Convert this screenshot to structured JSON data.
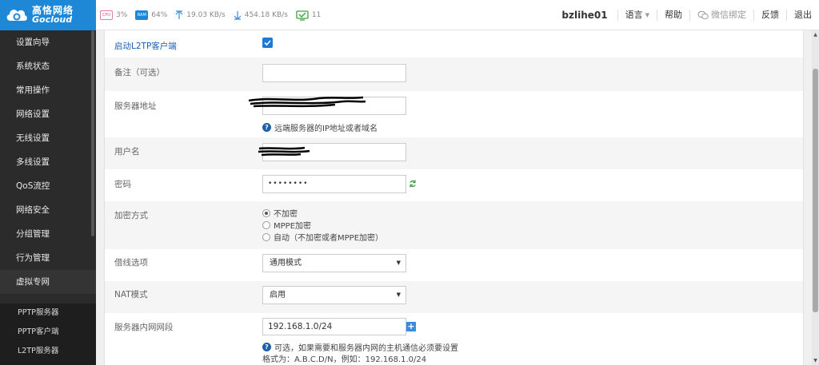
{
  "app": {
    "logo_cn": "高恪网络",
    "logo_en": "Gocloud"
  },
  "stats": {
    "cpu_badge": "CPU",
    "cpu": "3%",
    "ram_badge": "RAM",
    "ram": "64%",
    "upload": "19.03 KB/s",
    "download": "454.18 KB/s",
    "devices": "11"
  },
  "topnav": {
    "user": "bzlihe01",
    "language": "语言",
    "help": "帮助",
    "wechat": "微信绑定",
    "feedback": "反馈",
    "logout": "退出"
  },
  "sidebar": {
    "items": [
      {
        "label": "设置向导"
      },
      {
        "label": "系统状态"
      },
      {
        "label": "常用操作"
      },
      {
        "label": "网络设置"
      },
      {
        "label": "无线设置"
      },
      {
        "label": "多线设置"
      },
      {
        "label": "QoS流控"
      },
      {
        "label": "网络安全"
      },
      {
        "label": "分组管理"
      },
      {
        "label": "行为管理"
      },
      {
        "label": "虚拟专网"
      }
    ],
    "subitems": [
      {
        "label": "PPTP服务器"
      },
      {
        "label": "PPTP客户端"
      },
      {
        "label": "L2TP服务器"
      }
    ]
  },
  "form": {
    "enable_label": "启动L2TP客户端",
    "enable_checked": true,
    "note_label": "备注（可选）",
    "note_value": "",
    "server_label": "服务器地址",
    "server_hint": "远端服务器的IP地址或者域名",
    "username_label": "用户名",
    "password_label": "密码",
    "password_value": "••••••••",
    "encryption_label": "加密方式",
    "encryption_options": [
      {
        "label": "不加密",
        "selected": true
      },
      {
        "label": "MPPE加密",
        "selected": false
      },
      {
        "label": "自动（不加密或者MPPE加密）",
        "selected": false
      }
    ],
    "line_label": "借线选项",
    "line_value": "通用模式",
    "nat_label": "NAT模式",
    "nat_value": "启用",
    "subnet_label": "服务器内网网段",
    "subnet_value": "192.168.1.0/24",
    "subnet_hint": "可选，如果需要和服务器内网的主机通信必须要设置",
    "subnet_format": "格式为：A.B.C.D/N，例如：192.168.1.0/24"
  },
  "colors": {
    "brand": "#1e88d6",
    "sidebar_bg": "#2b2b2b",
    "label_blue": "#1a5fb4"
  }
}
